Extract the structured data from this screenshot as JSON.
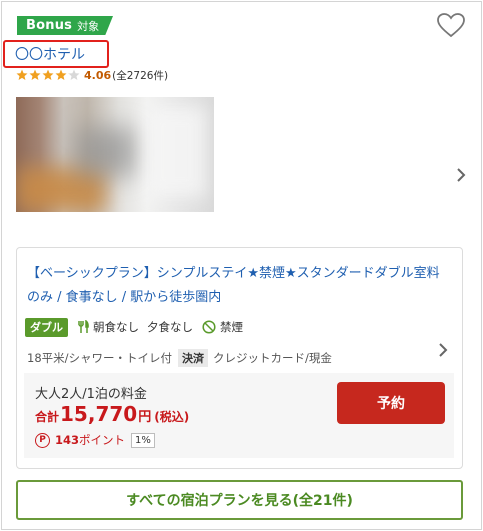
{
  "bonus": {
    "label": "Bonus",
    "suffix": "対象"
  },
  "hotel": {
    "name": "〇〇ホテル",
    "rating_value": 4.06,
    "rating_score": "4.06",
    "review_count": "(全2726件)",
    "star_fill": 0.81
  },
  "icons": {
    "favorite": "heart-icon",
    "next": "chevron-right-icon",
    "meal": "fork-knife-icon",
    "smoking": "no-smoking-icon",
    "points": "p-circle-icon"
  },
  "plan": {
    "title": "【ベーシックプラン】シンプルステイ★禁煙★スタンダードダブル室料のみ / 食事なし / 駅から徒歩圏内",
    "room_type": "ダブル",
    "breakfast": "朝食なし",
    "dinner": "夕食なし",
    "smoking": "禁煙",
    "room_detail": "18平米/シャワー・トイレ付",
    "payment_label": "決済",
    "payment_methods": "クレジットカード/現金"
  },
  "price": {
    "condition": "大人2人/1泊の料金",
    "total_label": "合計",
    "amount": "15,770",
    "currency": "円",
    "tax": "(税込)",
    "points": "143",
    "points_unit": "ポイント",
    "points_rate": "1%"
  },
  "buttons": {
    "reserve": "予約",
    "all_plans": "すべての宿泊プランを見る(全21件)"
  },
  "colors": {
    "bonus_green": "#2fa64a",
    "link_blue": "#1f5fb0",
    "price_red": "#c8191c",
    "reserve_red": "#c6281e",
    "outline_green": "#6a9a3a",
    "highlight_red": "#e2211c"
  }
}
